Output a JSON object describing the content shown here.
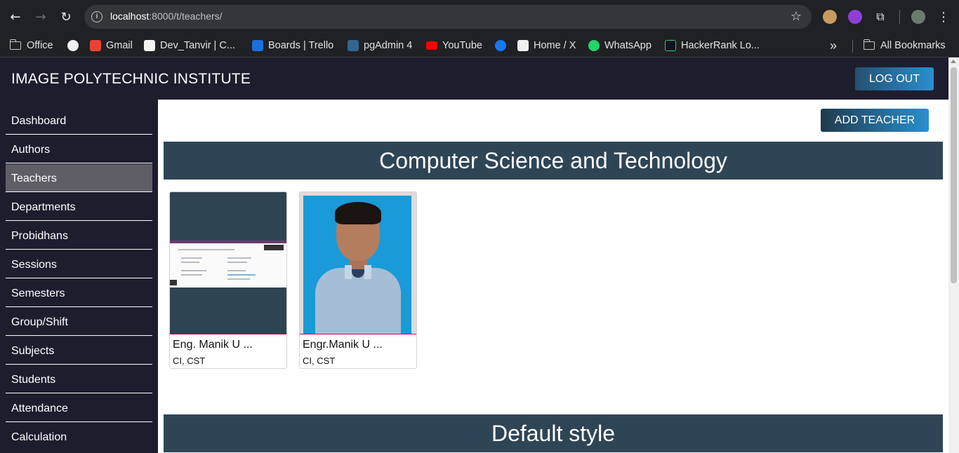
{
  "browser": {
    "url_host": "localhost",
    "url_path": ":8000/t/teachers/",
    "bookmarks": [
      {
        "label": "Office",
        "icon": "folder-icon"
      },
      {
        "label": "",
        "icon": "github-icon"
      },
      {
        "label": "Gmail",
        "icon": "gmail-icon"
      },
      {
        "label": "Dev_Tanvir | C...",
        "icon": "dev-icon"
      },
      {
        "label": "Boards | Trello",
        "icon": "trello-icon"
      },
      {
        "label": "pgAdmin 4",
        "icon": "pgadmin-icon"
      },
      {
        "label": "YouTube",
        "icon": "youtube-icon"
      },
      {
        "label": "",
        "icon": "facebook-icon"
      },
      {
        "label": "Home / X",
        "icon": "x-icon"
      },
      {
        "label": "WhatsApp",
        "icon": "whatsapp-icon"
      },
      {
        "label": "HackerRank Lo...",
        "icon": "hackerrank-icon"
      }
    ],
    "more_bookmarks": "»",
    "all_bookmarks": "All Bookmarks"
  },
  "header": {
    "title": "IMAGE POLYTECHNIC INSTITUTE",
    "logout_label": "LOG OUT"
  },
  "sidebar": {
    "items": [
      {
        "label": "Dashboard",
        "active": false
      },
      {
        "label": "Authors",
        "active": false
      },
      {
        "label": "Teachers",
        "active": true
      },
      {
        "label": "Departments",
        "active": false
      },
      {
        "label": "Probidhans",
        "active": false
      },
      {
        "label": "Sessions",
        "active": false
      },
      {
        "label": "Semesters",
        "active": false
      },
      {
        "label": "Group/Shift",
        "active": false
      },
      {
        "label": "Subjects",
        "active": false
      },
      {
        "label": "Students",
        "active": false
      },
      {
        "label": "Attendance",
        "active": false
      },
      {
        "label": "Calculation",
        "active": false
      }
    ]
  },
  "main": {
    "add_teacher_label": "ADD TEACHER",
    "departments": [
      {
        "name": "Computer Science and Technology",
        "teachers": [
          {
            "name": "Eng. Manik U ...",
            "meta": "CI, CST",
            "photo": "screenshot-thumbnail"
          },
          {
            "name": "Engr.Manik U ...",
            "meta": "CI, CST",
            "photo": "portrait-photo"
          }
        ]
      },
      {
        "name": "Default style",
        "teachers": []
      }
    ]
  },
  "colors": {
    "header_bg": "#1e1d2e",
    "banner_bg": "#2e4556",
    "active_item": "#5f5e67",
    "button_gradient_end": "#2a8fce"
  }
}
